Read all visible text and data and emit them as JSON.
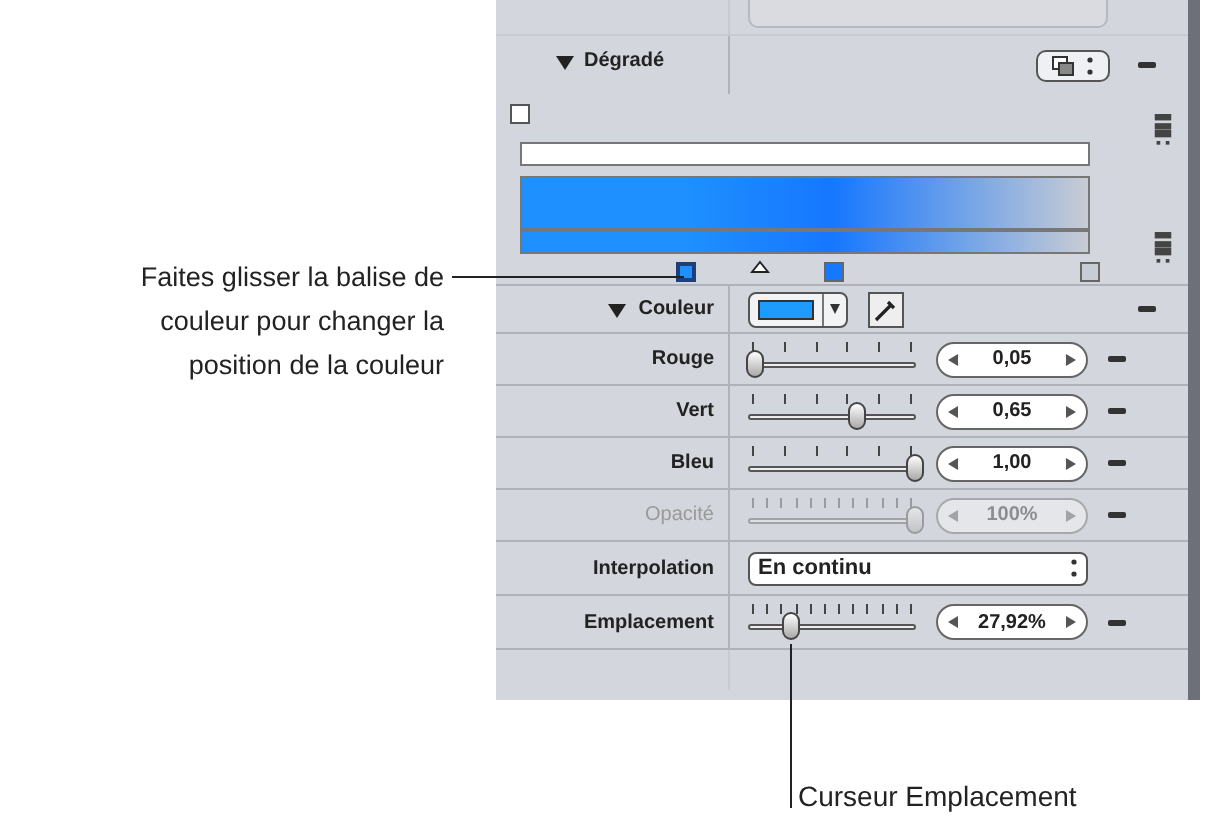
{
  "gradient": {
    "label": "Dégradé",
    "expanded": true,
    "opacity_tags": [
      {
        "color": "#ffffff"
      }
    ],
    "color_tags": [
      {
        "kind": "color",
        "color": "#1e90ff",
        "selected": true
      },
      {
        "kind": "midpoint"
      },
      {
        "kind": "color",
        "color": "#1677ff",
        "selected": false
      },
      {
        "kind": "color",
        "color": "#c8ccd4",
        "selected": false
      }
    ]
  },
  "color": {
    "label": "Couleur",
    "expanded": true,
    "color": "#1e9bff"
  },
  "channels": [
    {
      "name": "Rouge",
      "level": 0.05,
      "reading": "0,05",
      "disabled": false
    },
    {
      "name": "Vert",
      "level": 0.65,
      "reading": "0,65",
      "disabled": false
    },
    {
      "name": "Bleu",
      "level": 1,
      "reading": "1,00",
      "disabled": false
    },
    {
      "name": "Opacité",
      "level": 1,
      "reading": "100%",
      "disabled": true
    }
  ],
  "interpolation": {
    "label": "Interpolation",
    "value": "En continu"
  },
  "location": {
    "name": "Emplacement",
    "level": 0.26,
    "reading": "27,92%"
  },
  "callouts": [
    {
      "lines": [
        "Faites glisser la balise de",
        "couleur pour changer la",
        "position de la couleur"
      ]
    },
    {
      "lines": [
        "Curseur Emplacement"
      ]
    }
  ]
}
